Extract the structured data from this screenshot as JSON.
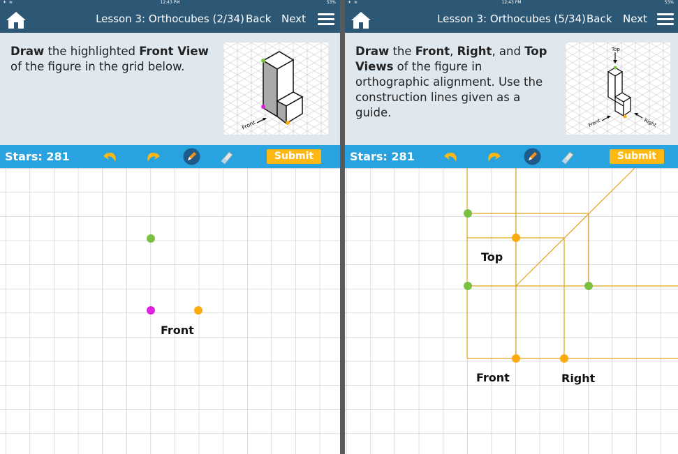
{
  "status": {
    "time": "12:43 PM",
    "battery": "53%"
  },
  "left": {
    "title": "Lesson 3: Orthocubes (2/34)",
    "back": "Back",
    "next": "Next",
    "instruction": {
      "p1": "Draw",
      "p2": " the highlighted ",
      "p3": "Front View",
      "p4": " of the figure in the grid below."
    },
    "figure_label": "Front",
    "stars": "Stars: 281",
    "submit": "Submit",
    "grid_label_front": "Front"
  },
  "right": {
    "title": "Lesson 3: Orthocubes (5/34)",
    "back": "Back",
    "next": "Next",
    "instruction": {
      "p1": "Draw",
      "p2": " the ",
      "p3": "Front",
      "p4": ", ",
      "p5": "Right",
      "p6": ", and ",
      "p7": "Top Views",
      "p8": " of the figure in orthographic alignment. Use the construction lines given as a guide."
    },
    "figure_labels": {
      "top": "Top",
      "front": "Front",
      "right": "Right"
    },
    "stars": "Stars: 281",
    "submit": "Submit",
    "grid_labels": {
      "top": "Top",
      "front": "Front",
      "right": "Right"
    }
  },
  "colors": {
    "nav": "#2c5876",
    "toolbar": "#29a3df",
    "submit": "#fdb813",
    "green": "#7ac143",
    "magenta": "#e020e0",
    "orange": "#fbaa10",
    "construction": "#e3a520"
  }
}
